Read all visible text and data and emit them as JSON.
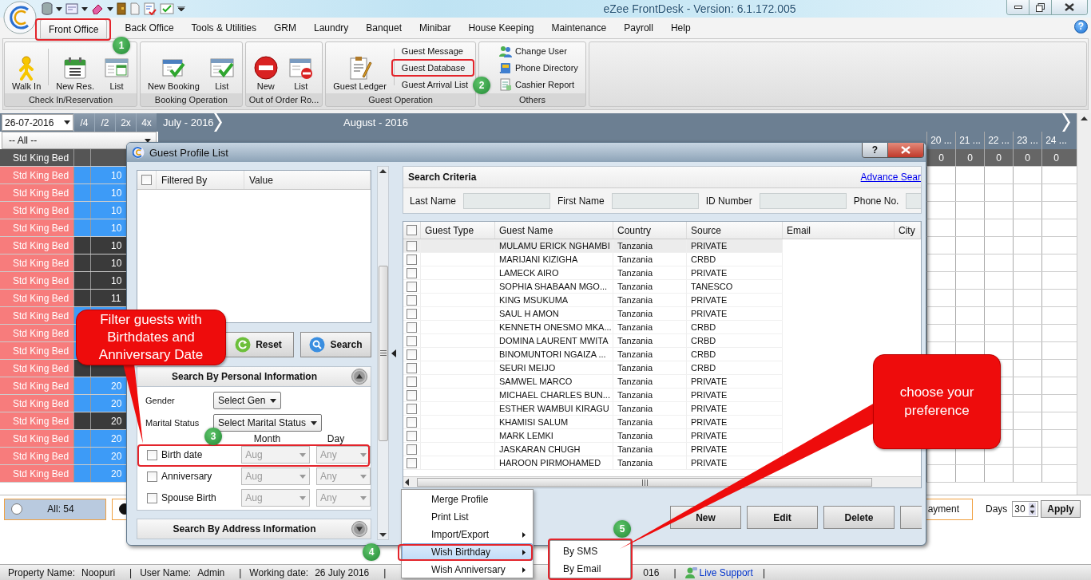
{
  "window": {
    "title": "eZee FrontDesk - Version: 6.1.172.005",
    "help_button": "?"
  },
  "menu_tabs": [
    {
      "label": "Front Office",
      "selected": true
    },
    {
      "label": "Back Office",
      "selected": false
    },
    {
      "label": "Tools & Utilities",
      "selected": false
    },
    {
      "label": "GRM",
      "selected": false
    },
    {
      "label": "Laundry",
      "selected": false
    },
    {
      "label": "Banquet",
      "selected": false
    },
    {
      "label": "Minibar",
      "selected": false
    },
    {
      "label": "House Keeping",
      "selected": false
    },
    {
      "label": "Maintenance",
      "selected": false
    },
    {
      "label": "Payroll",
      "selected": false
    },
    {
      "label": "Help",
      "selected": false
    }
  ],
  "ribbon_groups": [
    {
      "label": "Check In/Reservation",
      "buttons": [
        {
          "kind": "large",
          "label": "Walk In",
          "separator_after": true
        },
        {
          "kind": "large",
          "label": "New Res."
        },
        {
          "kind": "large",
          "label": "List"
        }
      ]
    },
    {
      "label": "Booking Operation",
      "buttons": [
        {
          "kind": "large",
          "label": "New Booking"
        },
        {
          "kind": "large",
          "label": "List"
        }
      ]
    },
    {
      "label": "Out of Order Ro...",
      "buttons": [
        {
          "kind": "large",
          "label": "New"
        },
        {
          "kind": "large",
          "label": "List"
        }
      ]
    },
    {
      "label": "Guest Operation",
      "buttons": [
        {
          "kind": "large",
          "label": "Guest Ledger",
          "separator_after": true
        },
        {
          "kind": "small",
          "label": "Guest Message"
        },
        {
          "kind": "small",
          "label": "Guest Database"
        },
        {
          "kind": "small",
          "label": "Guest Arrival List"
        }
      ]
    },
    {
      "label": "Others",
      "buttons": [
        {
          "kind": "small",
          "label": "Change User"
        },
        {
          "kind": "small",
          "label": "Phone Directory"
        },
        {
          "kind": "small",
          "label": "Cashier Report"
        }
      ]
    }
  ],
  "calendar": {
    "date": "26-07-2016",
    "zoom_buttons": [
      "/4",
      "/2",
      "2x",
      "4x"
    ],
    "room_filter": "-- All --",
    "months": [
      "July - 2016",
      "August - 2016"
    ],
    "days": [
      "20 ...",
      "21 ...",
      "22 ...",
      "23 ...",
      "24 ..."
    ],
    "counts": [
      "0",
      "0",
      "0",
      "0",
      "0"
    ]
  },
  "rooms": {
    "header": "Std King Bed",
    "rows": [
      {
        "type": "Std King Bed",
        "room": "10",
        "color": "#3d9bf7"
      },
      {
        "type": "Std King Bed",
        "room": "10",
        "color": "#3d9bf7"
      },
      {
        "type": "Std King Bed",
        "room": "10",
        "color": "#3d9bf7"
      },
      {
        "type": "Std King Bed",
        "room": "10",
        "color": "#3d9bf7"
      },
      {
        "type": "Std King Bed",
        "room": "10",
        "color": "#3a3a3a"
      },
      {
        "type": "Std King Bed",
        "room": "10",
        "color": "#3a3a3a"
      },
      {
        "type": "Std King Bed",
        "room": "10",
        "color": "#3a3a3a"
      },
      {
        "type": "Std King Bed",
        "room": "11",
        "color": "#3a3a3a"
      },
      {
        "type": "Std King Bed",
        "color": "#3d9bf7"
      },
      {
        "type": "Std King Bed",
        "color": "#3d9bf7"
      },
      {
        "type": "Std King Bed",
        "color": "#3d9bf7"
      },
      {
        "type": "Std King Bed",
        "color": "#3a3a3a"
      },
      {
        "type": "Std King Bed",
        "room": "20",
        "color": "#3d9bf7"
      },
      {
        "type": "Std King Bed",
        "room": "20",
        "color": "#3d9bf7"
      },
      {
        "type": "Std King Bed",
        "room": "20",
        "color": "#3a3a3a"
      },
      {
        "type": "Std King Bed",
        "room": "20",
        "color": "#3d9bf7"
      },
      {
        "type": "Std King Bed",
        "room": "20",
        "color": "#3d9bf7"
      },
      {
        "type": "Std King Bed",
        "room": "20",
        "color": "#3d9bf7"
      }
    ]
  },
  "legend": [
    {
      "kind": "radio",
      "label": "All: 54",
      "selected": false
    },
    {
      "kind": "radio",
      "label": "ayment",
      "selected": true
    }
  ],
  "days_filter": {
    "label": "Days",
    "value": "30",
    "button": "Apply"
  },
  "status_bar": [
    {
      "kind": "label",
      "text": "Property Name:"
    },
    {
      "kind": "value",
      "text": "Noopuri"
    },
    {
      "kind": "sep",
      "text": "|"
    },
    {
      "kind": "label",
      "text": "User Name:"
    },
    {
      "kind": "value",
      "text": "Admin"
    },
    {
      "kind": "sep",
      "text": "|"
    },
    {
      "kind": "label",
      "text": "Working date:"
    },
    {
      "kind": "value",
      "text": "26 July 2016"
    },
    {
      "kind": "sep",
      "text": "|"
    },
    {
      "kind": "value_after_menu",
      "text": "016"
    },
    {
      "kind": "sep",
      "text": "|"
    },
    {
      "kind": "link",
      "text": "Live Support"
    },
    {
      "kind": "sep",
      "text": "|"
    }
  ],
  "dialog": {
    "title": "Guest Profile List",
    "help_button": "?",
    "filter_table": {
      "checked": false,
      "columns": [
        "Filtered By",
        "Value"
      ]
    },
    "buttons": [
      {
        "kind": "reset",
        "label": "Reset"
      },
      {
        "kind": "search",
        "label": "Search"
      }
    ],
    "personal_section": {
      "title": "Search By Personal Information",
      "expanded": true,
      "selects": [
        {
          "label": "Gender",
          "value": "Select Gen"
        },
        {
          "label": "Marital Status",
          "value": "Select Marital Status"
        }
      ],
      "date_columns": [
        "Month",
        "Day"
      ],
      "date_filters": [
        {
          "label": "Birth date",
          "checked": false,
          "month": "Aug",
          "day": "Any",
          "disabled": true
        },
        {
          "label": "Anniversary",
          "checked": false,
          "month": "Aug",
          "day": "Any",
          "disabled": true
        },
        {
          "label": "Spouse Birth",
          "checked": false,
          "month": "Aug",
          "day": "Any",
          "disabled": true
        }
      ]
    },
    "address_section": {
      "title": "Search By Address Information",
      "expanded": false
    },
    "criteria": {
      "title": "Search Criteria",
      "link": "Advance Sear",
      "fields": [
        {
          "label": "Last Name"
        },
        {
          "label": "First Name"
        },
        {
          "label": "ID Number"
        },
        {
          "label": "Phone No."
        }
      ]
    },
    "guests": {
      "checked": false,
      "columns": [
        "Guest Type",
        "Guest Name",
        "Country",
        "Source",
        "Email",
        "City"
      ],
      "rows": [
        {
          "name": "MULAMU ERICK NGHAMBI",
          "country": "Tanzania",
          "source": "PRIVATE",
          "checked": false,
          "selected": true
        },
        {
          "name": "MARIJANI KIZIGHA",
          "country": "Tanzania",
          "source": "CRBD",
          "checked": false,
          "selected": false
        },
        {
          "name": "LAMECK AIRO",
          "country": "Tanzania",
          "source": "PRIVATE",
          "checked": false,
          "selected": false
        },
        {
          "name": "SOPHIA SHABAAN MGO...",
          "country": "Tanzania",
          "source": "TANESCO",
          "checked": false,
          "selected": false
        },
        {
          "name": "KING MSUKUMA",
          "country": "Tanzania",
          "source": "PRIVATE",
          "checked": false,
          "selected": false
        },
        {
          "name": "SAUL H AMON",
          "country": "Tanzania",
          "source": "PRIVATE",
          "checked": false,
          "selected": false
        },
        {
          "name": "KENNETH ONESMO MKA...",
          "country": "Tanzania",
          "source": "CRBD",
          "checked": false,
          "selected": false
        },
        {
          "name": "DOMINA LAURENT MWITA",
          "country": "Tanzania",
          "source": "CRBD",
          "checked": false,
          "selected": false
        },
        {
          "name": "BINOMUNTORI NGAIZA ...",
          "country": "Tanzania",
          "source": "CRBD",
          "checked": false,
          "selected": false
        },
        {
          "name": "SEURI MEIJO",
          "country": "Tanzania",
          "source": "CRBD",
          "checked": false,
          "selected": false
        },
        {
          "name": "SAMWEL MARCO",
          "country": "Tanzania",
          "source": "PRIVATE",
          "checked": false,
          "selected": false
        },
        {
          "name": "MICHAEL CHARLES BUN...",
          "country": "Tanzania",
          "source": "PRIVATE",
          "checked": false,
          "selected": false
        },
        {
          "name": "ESTHER WAMBUI KIRAGU",
          "country": "Tanzania",
          "source": "PRIVATE",
          "checked": false,
          "selected": false
        },
        {
          "name": "KHAMISI SALUM",
          "country": "Tanzania",
          "source": "PRIVATE",
          "checked": false,
          "selected": false
        },
        {
          "name": "MARK LEMKI",
          "country": "Tanzania",
          "source": "PRIVATE",
          "checked": false,
          "selected": false
        },
        {
          "name": "JASKARAN CHUGH",
          "country": "Tanzania",
          "source": "PRIVATE",
          "checked": false,
          "selected": false
        },
        {
          "name": "HAROON PIRMOHAMED",
          "country": "Tanzania",
          "source": "PRIVATE",
          "checked": false,
          "selected": false
        }
      ]
    },
    "actions": [
      "New",
      "Edit",
      "Delete"
    ]
  },
  "context_menu": {
    "items": [
      {
        "label": "Merge Profile",
        "selected": false,
        "submenu": false
      },
      {
        "label": "Print List",
        "selected": false,
        "submenu": false
      },
      {
        "label": "Import/Export",
        "selected": false,
        "submenu": true
      },
      {
        "label": "Wish Birthday",
        "selected": true,
        "submenu": true
      },
      {
        "label": "Wish Anniversary",
        "selected": false,
        "submenu": true
      }
    ],
    "submenu": [
      {
        "label": "By SMS"
      },
      {
        "label": "By Email"
      }
    ]
  },
  "annotations": {
    "steps": [
      "1",
      "2",
      "3",
      "4",
      "5"
    ],
    "callouts": [
      "Filter guests with Birthdates and Anniversary Date",
      "choose your preference"
    ]
  }
}
